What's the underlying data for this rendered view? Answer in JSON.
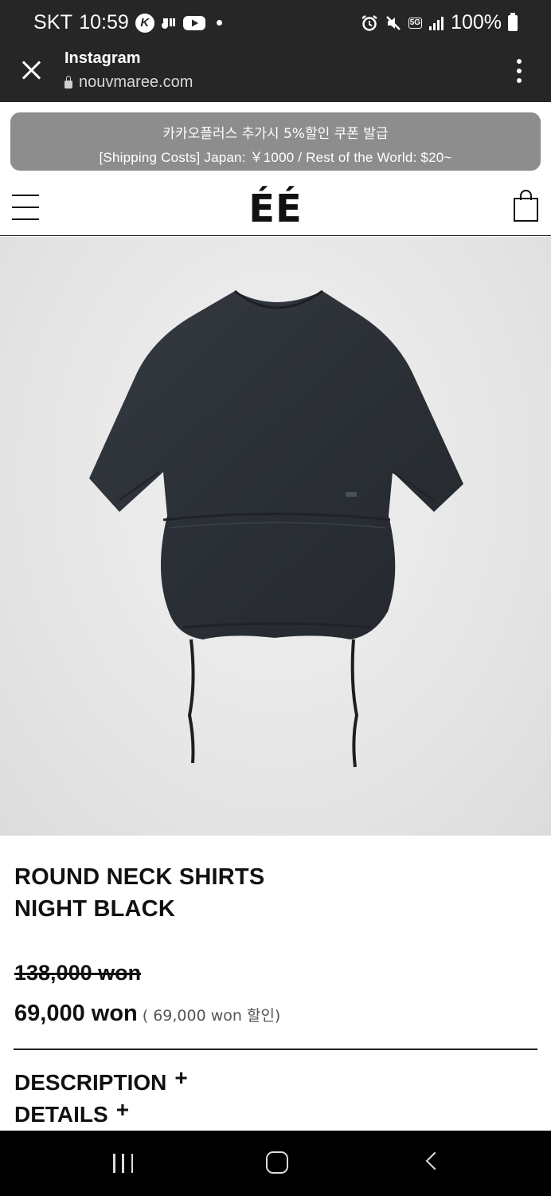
{
  "status_bar": {
    "carrier": "SKT",
    "time": "10:59",
    "network": "5G",
    "battery": "100%",
    "icons": [
      "k-app-icon",
      "music-app-icon",
      "youtube-icon",
      "notification-dot-icon",
      "alarm-icon",
      "mute-icon",
      "5g-icon",
      "signal-icon",
      "battery-icon"
    ]
  },
  "browser": {
    "title": "Instagram",
    "url": "nouvmaree.com"
  },
  "promo": {
    "line1": "카카오플러스 추가시 5%할인 쿠폰 발급",
    "line2": "[Shipping Costs] Japan: ￥1000 / Rest of the World: $20~"
  },
  "header": {
    "logo": "ÉÉ"
  },
  "product": {
    "name_line1": "ROUND NECK SHIRTS",
    "name_line2": "NIGHT BLACK",
    "original_price": "138,000 won",
    "sale_price": "69,000 won",
    "discount_note": "( 69,000 won 할인)",
    "image_color": "#2b3036"
  },
  "sections": {
    "description": "DESCRIPTION",
    "details": "DETAILS",
    "expand_symbol": "+"
  },
  "colors": {
    "status_bar_bg": "#262626",
    "promo_bg": "#8d8d8d",
    "nav_bg": "#000000"
  }
}
